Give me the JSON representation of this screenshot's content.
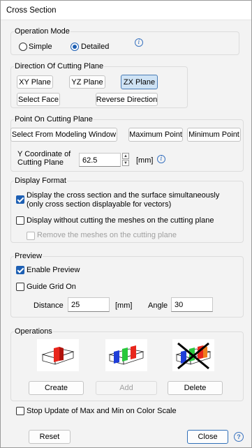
{
  "window": {
    "title": "Cross Section"
  },
  "operation_mode": {
    "title": "Operation Mode",
    "simple_label": "Simple",
    "detailed_label": "Detailed",
    "selected": "Detailed"
  },
  "direction": {
    "title": "Direction Of Cutting Plane",
    "xy_label": "XY Plane",
    "yz_label": "YZ Plane",
    "zx_label": "ZX Plane",
    "selected": "ZX Plane",
    "select_face_label": "Select Face",
    "reverse_label": "Reverse Direction"
  },
  "point": {
    "title": "Point On Cutting Plane",
    "select_window_label": "Select From Modeling Window",
    "max_label": "Maximum Point",
    "min_label": "Minimum Point",
    "ycoord_label_line1": "Y Coordinate of",
    "ycoord_label_line2": "Cutting Plane",
    "ycoord_value": "62.5",
    "unit": "[mm]"
  },
  "display_format": {
    "title": "Display Format",
    "opt1_line1": "Display the cross section and the surface simultaneously",
    "opt1_line2": "(only cross section displayable for vectors)",
    "opt1_checked": true,
    "opt2_label": "Display without cutting the meshes on the cutting plane",
    "opt2_checked": false,
    "opt3_label": "Remove the meshes on the cutting plane",
    "opt3_checked": false
  },
  "preview": {
    "title": "Preview",
    "enable_label": "Enable Preview",
    "enable_checked": true,
    "guide_label": "Guide Grid On",
    "guide_checked": false,
    "distance_label": "Distance",
    "distance_value": "25",
    "distance_unit": "[mm]",
    "angle_label": "Angle",
    "angle_value": "30"
  },
  "operations": {
    "title": "Operations",
    "create_label": "Create",
    "add_label": "Add",
    "delete_label": "Delete"
  },
  "footer": {
    "stop_update_label": "Stop Update of Max and Min on Color Scale",
    "stop_update_checked": false,
    "reset_label": "Reset",
    "close_label": "Close"
  },
  "colors": {
    "accent": "#1d5fb3",
    "selected_fill": "#cfe3f5",
    "red": "#e8261c",
    "green": "#28c83c",
    "blue": "#1f3ed8",
    "orange": "#f07e1e"
  }
}
